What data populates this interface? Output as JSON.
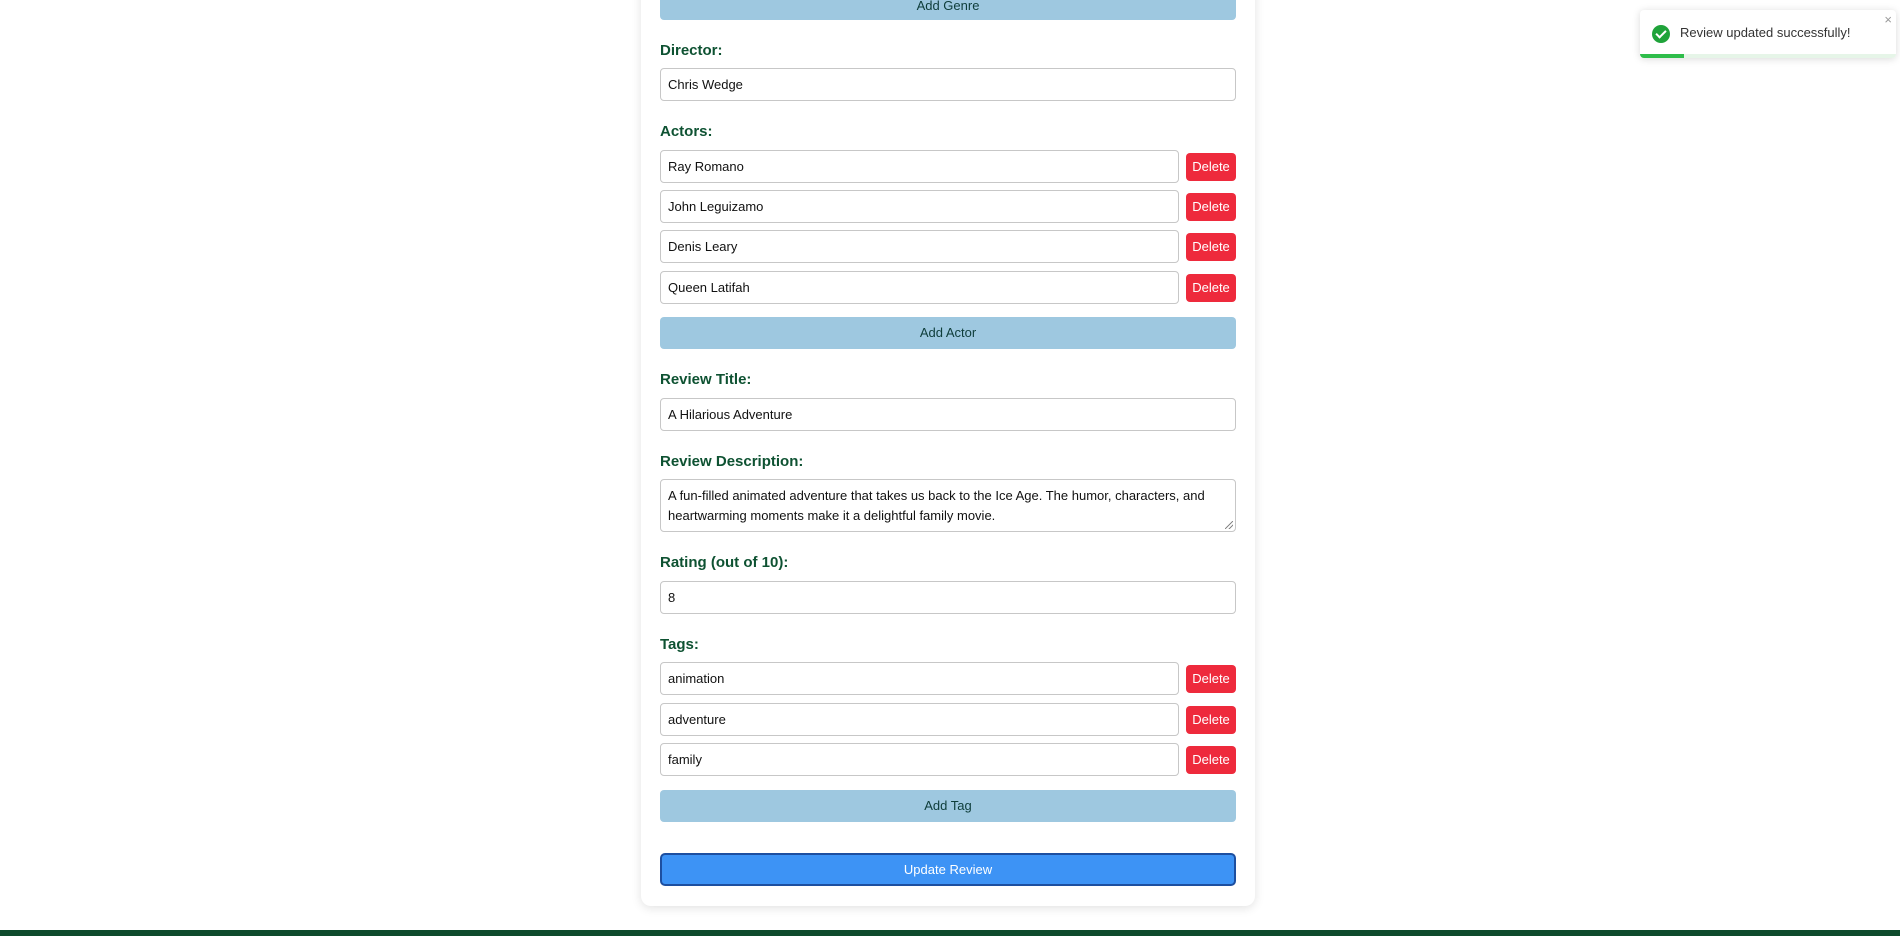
{
  "genre": {
    "add_label": "Add Genre"
  },
  "director": {
    "label": "Director:",
    "value": "Chris Wedge"
  },
  "actors": {
    "label": "Actors:",
    "items": [
      "Ray Romano",
      "John Leguizamo",
      "Denis Leary",
      "Queen Latifah"
    ],
    "add_label": "Add Actor"
  },
  "review_title": {
    "label": "Review Title:",
    "value": "A Hilarious Adventure"
  },
  "review_description": {
    "label": "Review Description:",
    "value": "A fun-filled animated adventure that takes us back to the Ice Age. The humor, characters, and heartwarming moments make it a delightful family movie."
  },
  "rating": {
    "label": "Rating (out of 10):",
    "value": "8"
  },
  "tags": {
    "label": "Tags:",
    "items": [
      "animation",
      "adventure",
      "family"
    ],
    "add_label": "Add Tag"
  },
  "delete_label": "Delete",
  "submit_label": "Update Review",
  "toast": {
    "message": "Review updated successfully!",
    "close_symbol": "×",
    "icon": "check-circle-icon",
    "progress": 0.17
  },
  "colors": {
    "label": "#0e5232",
    "delete": "#ee2a3c",
    "add_button": "#9ec8e0",
    "submit": "#3d93f5",
    "footer": "#0e4b2c",
    "success": "#1fa33a"
  }
}
